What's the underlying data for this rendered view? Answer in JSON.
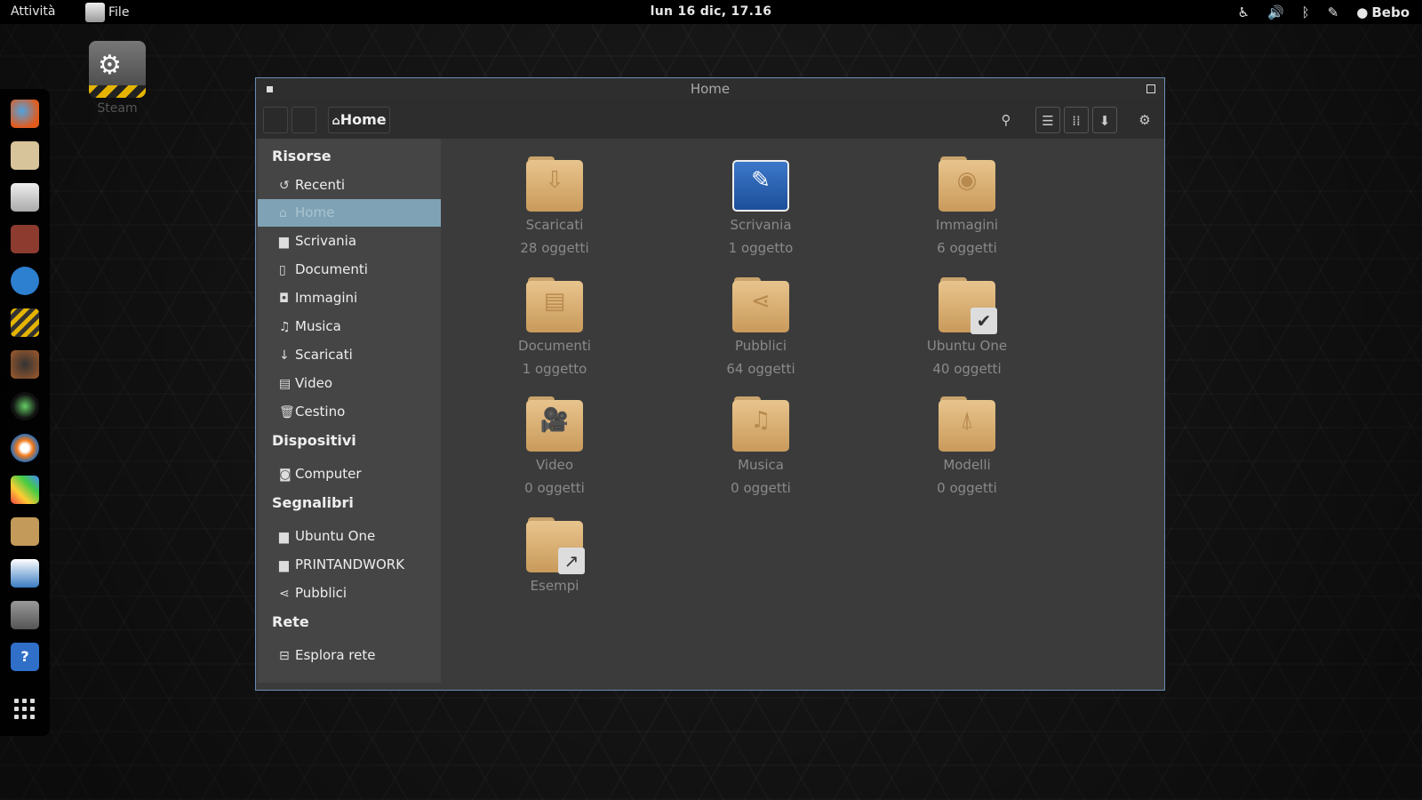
{
  "topbar": {
    "activities": "Attività",
    "app_menu": "File",
    "clock": "lun 16 dic, 17.16",
    "user": "Bebo"
  },
  "desktop": {
    "steam_label": "Steam"
  },
  "window": {
    "title": "Home",
    "path_button": "Home"
  },
  "sidebar": {
    "sections": [
      {
        "title": "Risorse",
        "items": [
          {
            "label": "Recenti",
            "icon": "recent-icon"
          },
          {
            "label": "Home",
            "icon": "home-icon",
            "selected": true
          },
          {
            "label": "Scrivania",
            "icon": "folder-icon"
          },
          {
            "label": "Documenti",
            "icon": "document-icon"
          },
          {
            "label": "Immagini",
            "icon": "camera-icon"
          },
          {
            "label": "Musica",
            "icon": "music-icon"
          },
          {
            "label": "Scaricati",
            "icon": "download-icon"
          },
          {
            "label": "Video",
            "icon": "film-icon"
          },
          {
            "label": "Cestino",
            "icon": "trash-icon"
          }
        ]
      },
      {
        "title": "Dispositivi",
        "items": [
          {
            "label": "Computer",
            "icon": "drive-icon"
          }
        ]
      },
      {
        "title": "Segnalibri",
        "items": [
          {
            "label": "Ubuntu One",
            "icon": "folder-icon"
          },
          {
            "label": "PRINTANDWORK",
            "icon": "folder-icon"
          },
          {
            "label": "Pubblici",
            "icon": "share-icon"
          }
        ]
      },
      {
        "title": "Rete",
        "items": [
          {
            "label": "Esplora rete",
            "icon": "network-icon"
          }
        ]
      }
    ]
  },
  "files": [
    {
      "name": "Scaricati",
      "count": "28 oggetti",
      "icon": "download-folder-icon"
    },
    {
      "name": "Scrivania",
      "count": "1 oggetto",
      "icon": "desktop-folder-icon"
    },
    {
      "name": "Immagini",
      "count": "6 oggetti",
      "icon": "pictures-folder-icon"
    },
    {
      "name": "Documenti",
      "count": "1 oggetto",
      "icon": "documents-folder-icon"
    },
    {
      "name": "Pubblici",
      "count": "64 oggetti",
      "icon": "public-folder-icon"
    },
    {
      "name": "Ubuntu One",
      "count": "40 oggetti",
      "icon": "ubuntu-one-folder-icon"
    },
    {
      "name": "Video",
      "count": "0 oggetti",
      "icon": "videos-folder-icon"
    },
    {
      "name": "Musica",
      "count": "0 oggetti",
      "icon": "music-folder-icon"
    },
    {
      "name": "Modelli",
      "count": "0 oggetti",
      "icon": "templates-folder-icon"
    },
    {
      "name": "Esempi",
      "count": "",
      "icon": "examples-link-folder-icon"
    }
  ]
}
